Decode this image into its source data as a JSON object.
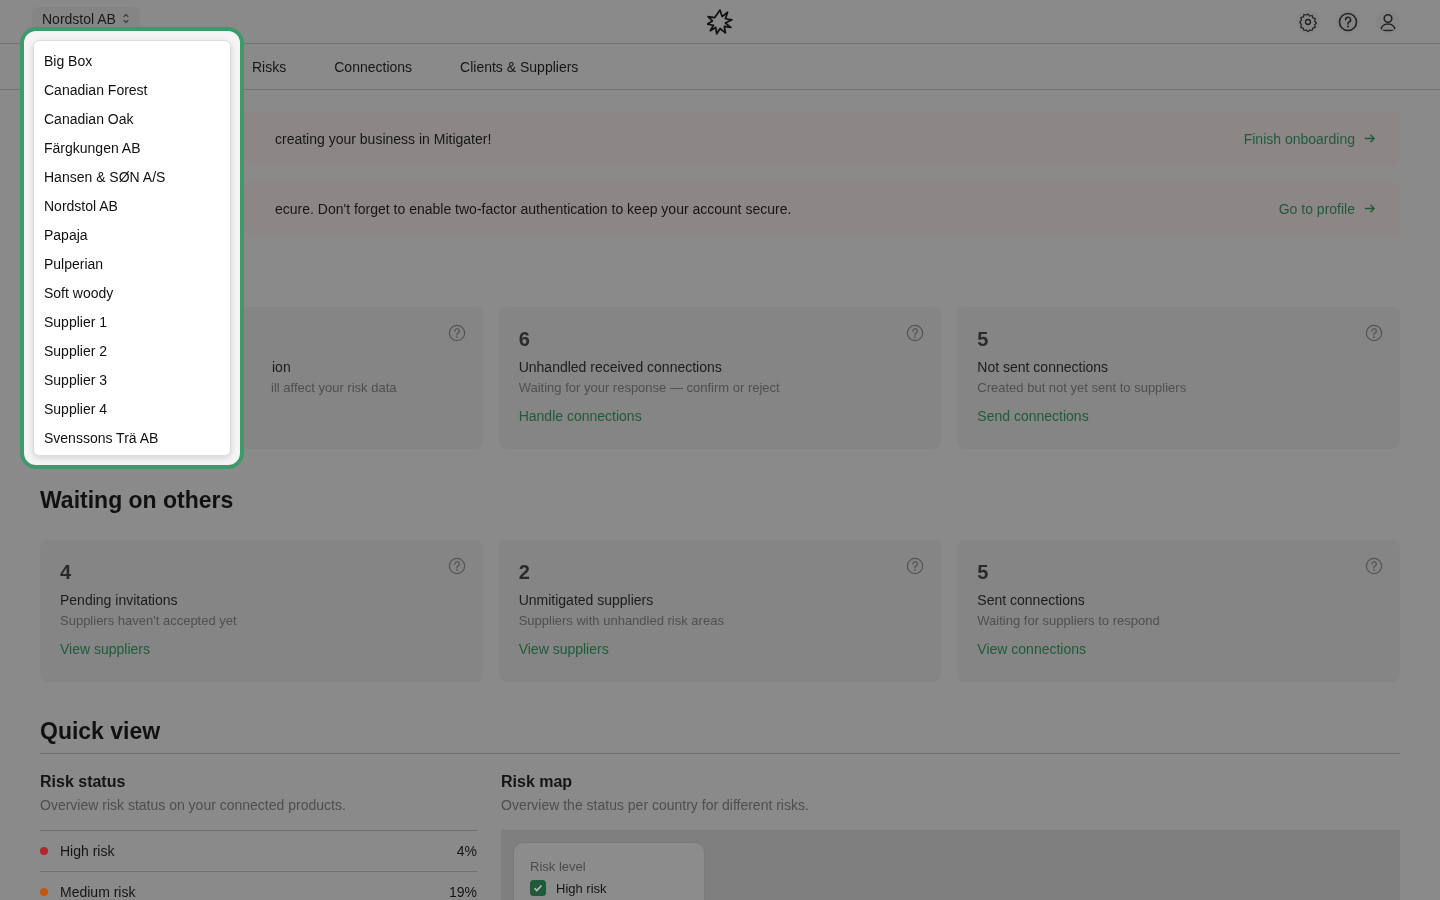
{
  "header": {
    "company": "Nordstol AB"
  },
  "tabs": [
    {
      "label": "Risks",
      "selected": false
    },
    {
      "label": "Connections",
      "selected": false
    },
    {
      "label": "Clients & Suppliers",
      "selected": false
    }
  ],
  "banners": [
    {
      "text": "creating your business in Mitigater!",
      "action": "Finish onboarding"
    },
    {
      "text": "ecure. Don't forget to enable two-factor authentication to keep your account secure.",
      "action": "Go to profile"
    }
  ],
  "action_cards": [
    {
      "title": "ion",
      "description": "ill affect your risk data"
    },
    {
      "count": "6",
      "title": "Unhandled received connections",
      "description": "Waiting for your response — confirm or reject",
      "link": "Handle connections"
    },
    {
      "count": "5",
      "title": "Not sent connections",
      "description": "Created but not yet sent to suppliers",
      "link": "Send connections"
    }
  ],
  "waiting": {
    "heading": "Waiting on others",
    "cards": [
      {
        "count": "4",
        "title": "Pending invitations",
        "description": "Suppliers haven't accepted yet",
        "link": "View suppliers"
      },
      {
        "count": "2",
        "title": "Unmitigated suppliers",
        "description": "Suppliers with unhandled risk areas",
        "link": "View suppliers"
      },
      {
        "count": "5",
        "title": "Sent connections",
        "description": "Waiting for suppliers to respond",
        "link": "View connections"
      }
    ]
  },
  "quick_view": {
    "heading": "Quick view",
    "risk_status": {
      "title": "Risk status",
      "subtitle": "Overview risk status on your connected products.",
      "rows": [
        {
          "label": "High risk",
          "value": "4%",
          "color": "#b3262b"
        },
        {
          "label": "Medium risk",
          "value": "19%",
          "color": "#c2570f"
        }
      ]
    },
    "risk_map": {
      "title": "Risk map",
      "subtitle": "Overview the status per country for different risks.",
      "legend": {
        "title": "Risk level",
        "items": [
          {
            "label": "High risk",
            "checked": true
          }
        ]
      }
    }
  },
  "company_menu": {
    "items": [
      {
        "label": "Big Box",
        "selected": false
      },
      {
        "label": "Canadian Forest",
        "selected": false
      },
      {
        "label": "Canadian Oak",
        "selected": false
      },
      {
        "label": "Färgkungen AB",
        "selected": false
      },
      {
        "label": "Hansen & SØN A/S",
        "selected": false
      },
      {
        "label": "Nordstol AB",
        "selected": false
      },
      {
        "label": "Papaja",
        "selected": false
      },
      {
        "label": "Pulperian",
        "selected": false
      },
      {
        "label": "Soft woody",
        "selected": false
      },
      {
        "label": "Supplier 1",
        "selected": false
      },
      {
        "label": "Supplier 2",
        "selected": false
      },
      {
        "label": "Supplier 3",
        "selected": false
      },
      {
        "label": "Supplier 4",
        "selected": false
      },
      {
        "label": "Svenssons Trä AB",
        "selected": false
      }
    ]
  }
}
